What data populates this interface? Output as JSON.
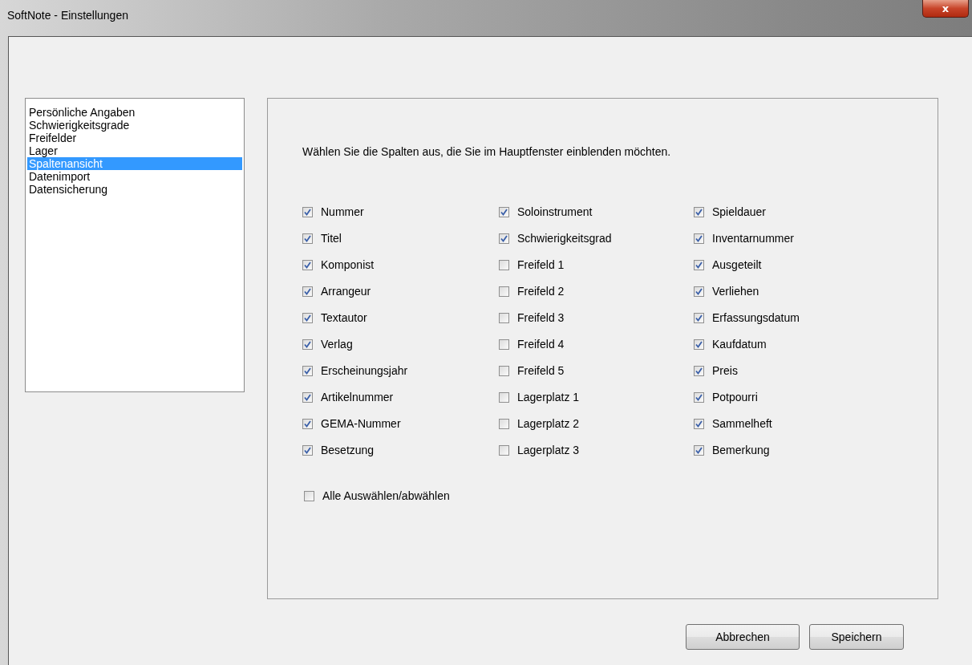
{
  "window": {
    "title": "SoftNote - Einstellungen",
    "close": "x"
  },
  "sidebar": {
    "items": [
      {
        "label": "Persönliche Angaben",
        "selected": false
      },
      {
        "label": "Schwierigkeitsgrade",
        "selected": false
      },
      {
        "label": "Freifelder",
        "selected": false
      },
      {
        "label": "Lager",
        "selected": false
      },
      {
        "label": "Spaltenansicht",
        "selected": true
      },
      {
        "label": "Datenimport",
        "selected": false
      },
      {
        "label": "Datensicherung",
        "selected": false
      }
    ]
  },
  "panel": {
    "instruction": "Wählen Sie die Spalten aus, die Sie im Hauptfenster einblenden möchten.",
    "columns": [
      [
        {
          "label": "Nummer",
          "checked": true
        },
        {
          "label": "Titel",
          "checked": true
        },
        {
          "label": "Komponist",
          "checked": true
        },
        {
          "label": "Arrangeur",
          "checked": true
        },
        {
          "label": "Textautor",
          "checked": true
        },
        {
          "label": "Verlag",
          "checked": true
        },
        {
          "label": "Erscheinungsjahr",
          "checked": true
        },
        {
          "label": "Artikelnummer",
          "checked": true
        },
        {
          "label": "GEMA-Nummer",
          "checked": true
        },
        {
          "label": "Besetzung",
          "checked": true
        }
      ],
      [
        {
          "label": "Soloinstrument",
          "checked": true
        },
        {
          "label": "Schwierigkeitsgrad",
          "checked": true
        },
        {
          "label": "Freifeld 1",
          "checked": false
        },
        {
          "label": "Freifeld 2",
          "checked": false
        },
        {
          "label": "Freifeld 3",
          "checked": false
        },
        {
          "label": "Freifeld 4",
          "checked": false
        },
        {
          "label": "Freifeld 5",
          "checked": false
        },
        {
          "label": "Lagerplatz 1",
          "checked": false
        },
        {
          "label": "Lagerplatz 2",
          "checked": false
        },
        {
          "label": "Lagerplatz 3",
          "checked": false
        }
      ],
      [
        {
          "label": "Spieldauer",
          "checked": true
        },
        {
          "label": "Inventarnummer",
          "checked": true
        },
        {
          "label": "Ausgeteilt",
          "checked": true
        },
        {
          "label": "Verliehen",
          "checked": true
        },
        {
          "label": "Erfassungsdatum",
          "checked": true
        },
        {
          "label": "Kaufdatum",
          "checked": true
        },
        {
          "label": "Preis",
          "checked": true
        },
        {
          "label": "Potpourri",
          "checked": true
        },
        {
          "label": "Sammelheft",
          "checked": true
        },
        {
          "label": "Bemerkung",
          "checked": true
        }
      ]
    ],
    "select_all": {
      "label": "Alle Auswählen/abwählen",
      "checked": false
    }
  },
  "buttons": [
    "Abbrechen",
    "Speichern"
  ]
}
